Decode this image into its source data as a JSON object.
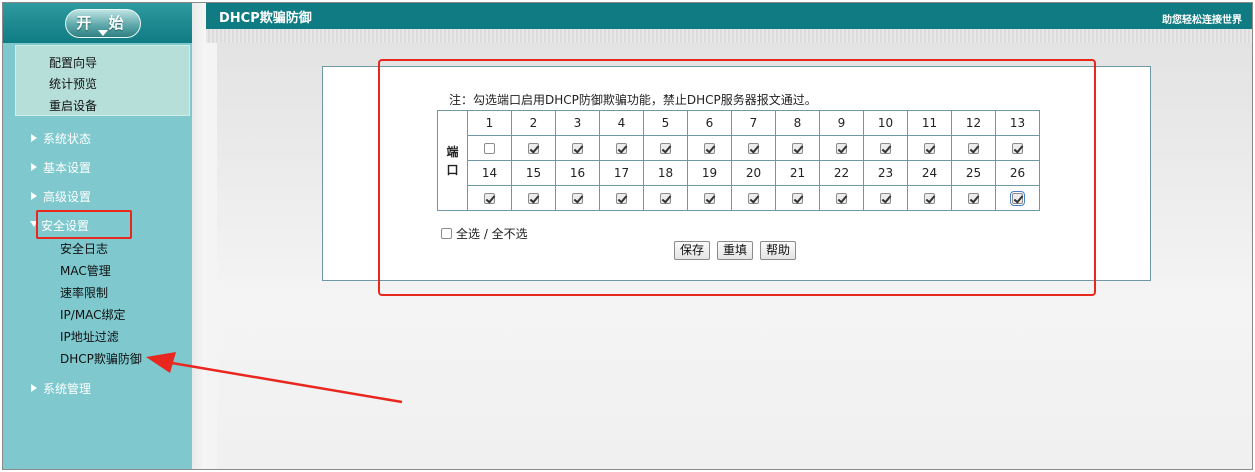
{
  "sidebar": {
    "start_label": "开 始",
    "quick_links": [
      "配置向导",
      "统计预览",
      "重启设备"
    ],
    "menu": [
      {
        "label": "系统状态",
        "expanded": false
      },
      {
        "label": "基本设置",
        "expanded": false
      },
      {
        "label": "高级设置",
        "expanded": false
      },
      {
        "label": "安全设置",
        "expanded": true
      },
      {
        "label": "系统管理",
        "expanded": false
      }
    ],
    "security_submenu": [
      "安全日志",
      "MAC管理",
      "速率限制",
      "IP/MAC绑定",
      "IP地址过滤",
      "DHCP欺骗防御"
    ]
  },
  "header": {
    "title": "DHCP欺骗防御",
    "slogan": "助您轻松连接世界"
  },
  "main": {
    "note": "注：勾选端口启用DHCP防御欺骗功能，禁止DHCP服务器报文通过。",
    "port_label": "端口",
    "row1_ports": [
      "1",
      "2",
      "3",
      "4",
      "5",
      "6",
      "7",
      "8",
      "9",
      "10",
      "11",
      "12",
      "13"
    ],
    "row1_checked": [
      false,
      true,
      true,
      true,
      true,
      true,
      true,
      true,
      true,
      true,
      true,
      true,
      true
    ],
    "row2_ports": [
      "14",
      "15",
      "16",
      "17",
      "18",
      "19",
      "20",
      "21",
      "22",
      "23",
      "24",
      "25",
      "26"
    ],
    "row2_checked": [
      true,
      true,
      true,
      true,
      true,
      true,
      true,
      true,
      true,
      true,
      true,
      true,
      true
    ],
    "select_all_label": "全选 / 全不选",
    "select_all_checked": false,
    "buttons": {
      "save": "保存",
      "reset": "重填",
      "help": "帮助"
    }
  },
  "colors": {
    "header_bg": "#107b82",
    "sidebar_bg": "#7ec8ce",
    "annotation_red": "#e8271f"
  }
}
